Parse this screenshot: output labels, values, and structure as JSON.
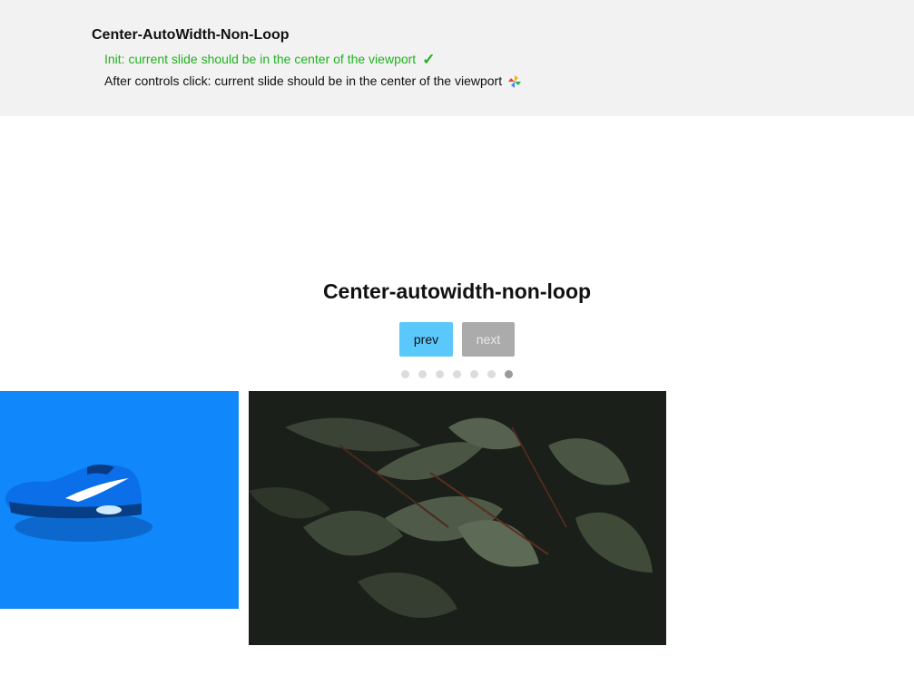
{
  "test_panel": {
    "title": "Center-AutoWidth-Non-Loop",
    "checks": [
      {
        "text": "Init: current slide should be in the center of the viewport",
        "status": "pass",
        "status_icon": "check-icon"
      },
      {
        "text": "After controls click: current slide should be in the center of the viewport",
        "status": "pending",
        "status_icon": "pinwheel-icon"
      }
    ]
  },
  "carousel": {
    "title": "Center-autowidth-non-loop",
    "controls": {
      "prev_label": "prev",
      "next_label": "next"
    },
    "dots": {
      "count": 7,
      "active_index": 6
    },
    "slides": [
      {
        "name": "blue-sneaker-photo"
      },
      {
        "name": "dark-leaves-photo"
      }
    ]
  },
  "colors": {
    "pass_text": "#1fb31f",
    "prev_button": "#5ac8fa",
    "next_button_disabled": "#ababab",
    "shoe_slide_bg": "#1088fb",
    "dot_inactive": "#dcdcdc",
    "dot_active": "#9a9a9a"
  }
}
